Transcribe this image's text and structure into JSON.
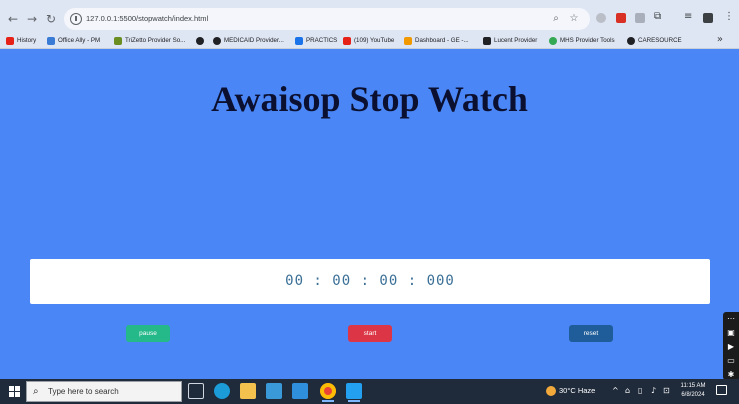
{
  "browser": {
    "url": "127.0.0.1:5500/stopwatch/index.html",
    "bookmarks": [
      {
        "label": "History",
        "icon": "youtube-icon",
        "color": "#e62117"
      },
      {
        "label": "Office Ally - PM",
        "icon": "office-ally-icon",
        "color": "#3a7bd5"
      },
      {
        "label": "TriZetto Provider So...",
        "icon": "trizetto-icon",
        "color": "#6b8e23"
      },
      {
        "label": "",
        "icon": "globe-icon",
        "color": "#202124"
      },
      {
        "label": "MEDICAID Provider...",
        "icon": "medicaid-icon",
        "color": "#202124"
      },
      {
        "label": "PRACTICS",
        "icon": "practics-icon",
        "color": "#1a73e8"
      },
      {
        "label": "(109) YouTube",
        "icon": "youtube-icon",
        "color": "#e62117"
      },
      {
        "label": "Dashboard - GE -...",
        "icon": "dashboard-icon",
        "color": "#f29900"
      },
      {
        "label": "Lucent Provider",
        "icon": "lucent-icon",
        "color": "#202124"
      },
      {
        "label": "MHS Provider Tools",
        "icon": "mhs-icon",
        "color": "#34a853"
      },
      {
        "label": "CARESOURCE",
        "icon": "caresource-icon",
        "color": "#202124"
      }
    ],
    "more_label": "»"
  },
  "page": {
    "title": "Awaisop Stop Watch",
    "time_display": "00 : 00 : 00 : 000",
    "buttons": {
      "pause": "pause",
      "start": "start",
      "reset": "reset"
    },
    "colors": {
      "background": "#4a86f6",
      "pause": "#25b889",
      "start": "#dc3545",
      "reset": "#1f5d9a"
    }
  },
  "taskbar": {
    "search_placeholder": "Type here to search",
    "weather": "30°C  Haze",
    "time": "11:15 AM",
    "date": "6/8/2024"
  }
}
